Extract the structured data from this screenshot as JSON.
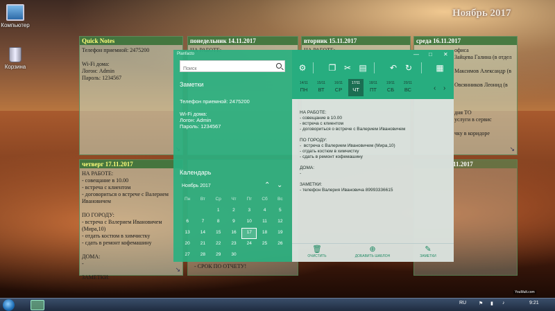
{
  "desktop": {
    "icons": [
      {
        "label": "Компьютер"
      },
      {
        "label": "Корзина"
      }
    ],
    "month_title": "Ноябрь 2017"
  },
  "quick_notes": {
    "title": "Quick Notes",
    "text": "Телефон приемной: 2475200\n\nWi-Fi дома:\nЛогон: Admin\nПароль: 1234567"
  },
  "day_columns": [
    {
      "title": "понедельник 14.11.2017",
      "text": "НА РАБОТЕ:"
    },
    {
      "title": "вторник 15.11.2017",
      "text": "НА РАБОТЕ:"
    },
    {
      "title": "среда 16.11.2017",
      "text": "офиса\nЗайцева Галина (в отдел\n\nМаксимов Александр (в\n\nОвсянников Леонид (в\n\n\n\nдня ТО\nуслуги в сервис\n\nчку в коридоре"
    }
  ],
  "thursday_column": {
    "title": "четверг 17.11.2017",
    "text": "НА РАБОТЕ:\n- совещание в 10.00\n- встреча с клиентом\n- договориться о встрече с Валерием\nИвановичем\n\nПО ГОРОДУ:\n- встреча с Валерием Ивановичем (Мира,10)\n- отдать костюм в химчистку\n- сдать в ремонт кофемашину\n\nДОМА:\n-\n\nЗАМЕТКИ:"
  },
  "friday_partial": {
    "text": "- СРОК ПО ОТЧЕТУ!"
  },
  "right_partial": {
    "title": "11.2017"
  },
  "app": {
    "window_title": "Planfacto",
    "search_placeholder": "Поиск",
    "notes_title": "Заметки",
    "notes_text": "Телефон приемной: 2475200\n\nWi-Fi дома:\nЛогон: Admin\nПароль: 1234567",
    "calendar_title": "Календарь",
    "calendar_month": "Ноябрь 2017",
    "calendar_weekdays": [
      "Пн",
      "Вт",
      "Ср",
      "Чт",
      "Пт",
      "Сб",
      "Вс"
    ],
    "calendar_weeks": [
      [
        "",
        "",
        "1",
        "2",
        "3",
        "4",
        "5"
      ],
      [
        "6",
        "7",
        "8",
        "9",
        "10",
        "11",
        "12"
      ],
      [
        "13",
        "14",
        "15",
        "16",
        "17",
        "18",
        "19"
      ],
      [
        "20",
        "21",
        "22",
        "23",
        "24",
        "25",
        "26"
      ],
      [
        "27",
        "28",
        "29",
        "30",
        "",
        "",
        ""
      ]
    ],
    "calendar_today": "17",
    "week_days": [
      {
        "date": "14/11",
        "name": "ПН"
      },
      {
        "date": "15/11",
        "name": "ВТ"
      },
      {
        "date": "16/11",
        "name": "СР"
      },
      {
        "date": "17/11",
        "name": "ЧТ"
      },
      {
        "date": "18/11",
        "name": "ПТ"
      },
      {
        "date": "19/11",
        "name": "СБ"
      },
      {
        "date": "20/11",
        "name": "ВС"
      }
    ],
    "selected_day": "ЧТ",
    "day_text": "НА РАБОТЕ:\n- совещание в 10.00\n- встреча с клиентом\n- договориться о встрече с Валерием Ивановичем\n\nПО ГОРОДУ:\n-  встреча с Валерием Ивановичем (Мира,10)\n- отдать костюм в химчистку\n- сдать в ремонт кофемашину\n\nДОМА:\n-\n\nЗАМЕТКИ:\n- телефон Валерия Ивановича 89993336615",
    "bottom": {
      "clear": "ОЧИСТИТЬ",
      "add_template": "ДОБАВИТЬ ШАБЛОН",
      "notes": "ЗАМЕТКИ"
    }
  },
  "taskbar": {
    "lang": "RU",
    "time": "9:21"
  },
  "watermark": "YouMult.com"
}
